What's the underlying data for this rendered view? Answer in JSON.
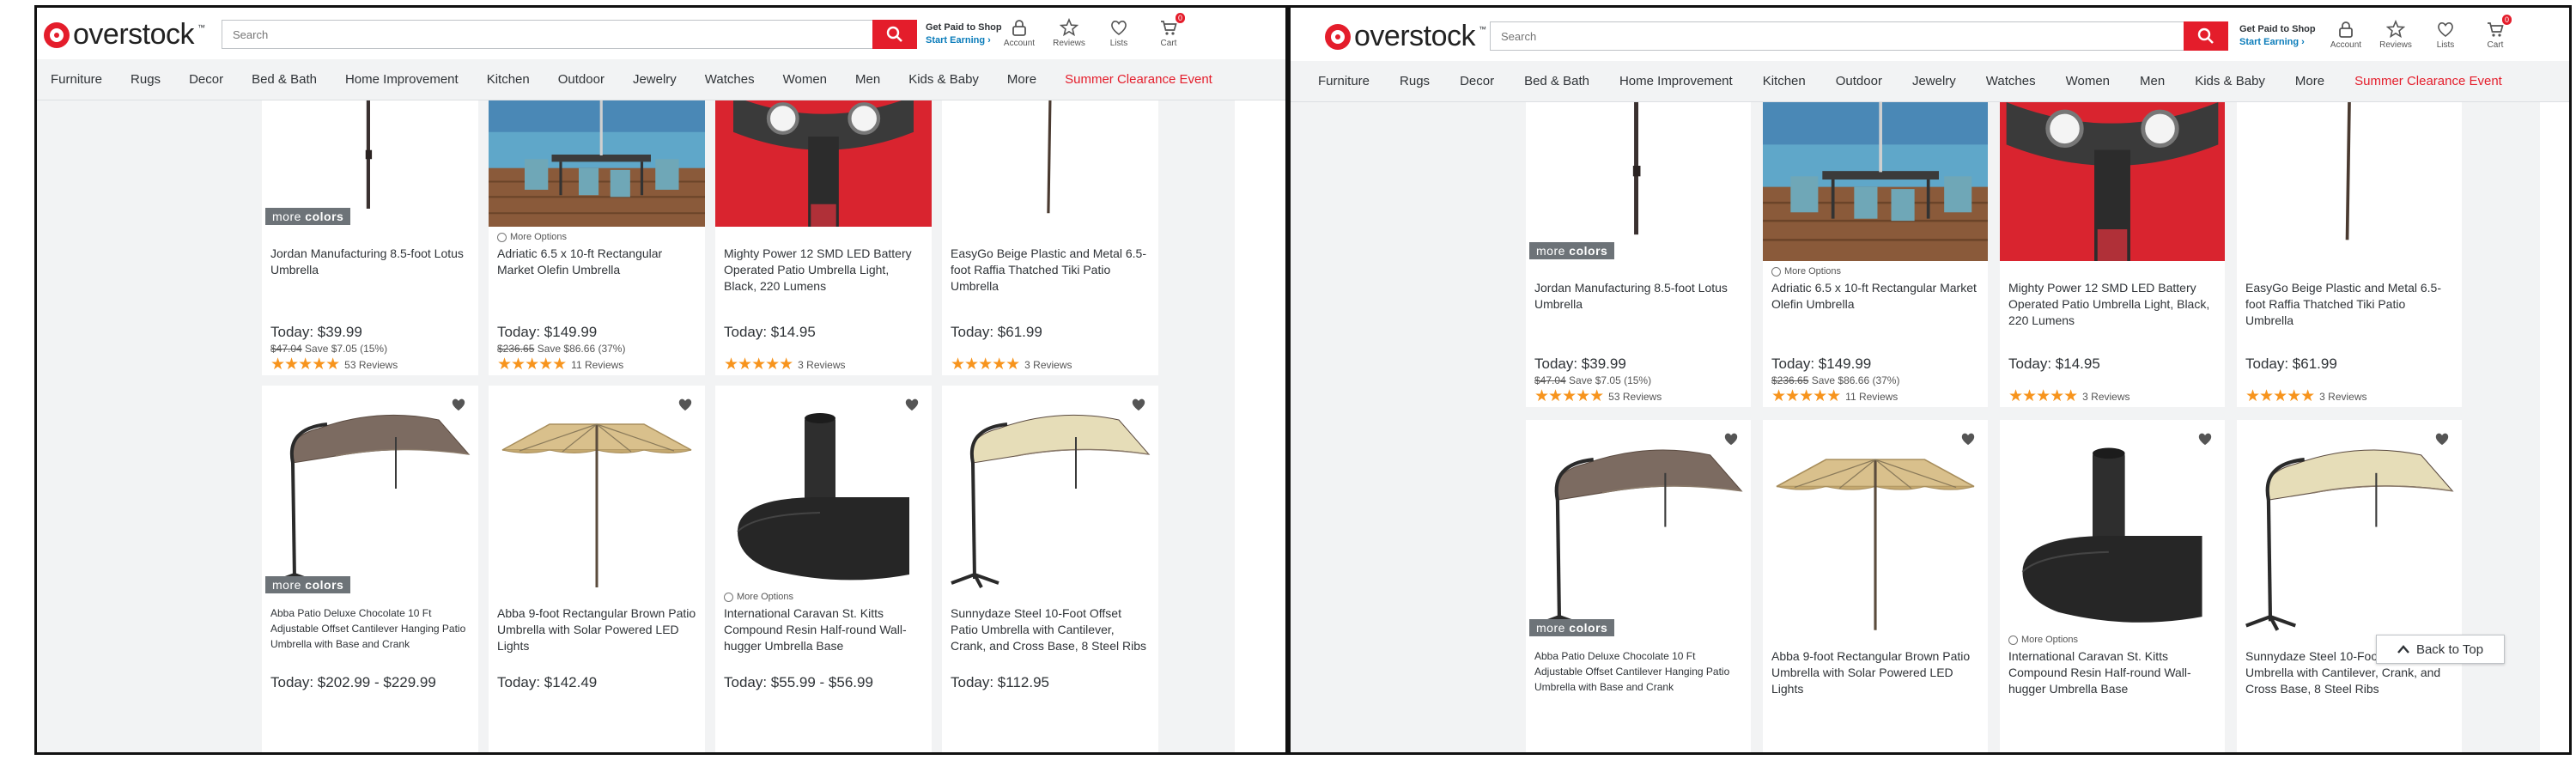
{
  "header": {
    "logo_text": "overstock",
    "search_placeholder": "Search",
    "earn_line1": "Get Paid to Shop",
    "earn_line2": "Start Earning ›",
    "account": "Account",
    "reviews": "Reviews",
    "lists": "Lists",
    "cart": "Cart",
    "cart_count": "0"
  },
  "nav": [
    "Furniture",
    "Rugs",
    "Decor",
    "Bed & Bath",
    "Home Improvement",
    "Kitchen",
    "Outdoor",
    "Jewelry",
    "Watches",
    "Women",
    "Men",
    "Kids & Baby",
    "More"
  ],
  "nav_sale": "Summer Clearance Event",
  "more_colors_label": "more colors",
  "more_options_label": "More Options",
  "back_to_top": "Back to Top",
  "products_row1": [
    {
      "title": "Jordan Manufacturing 8.5-foot Lotus Umbrella",
      "price": "Today: $39.99",
      "was": "$47.04",
      "save": "Save $7.05 (15%)",
      "stars": "★★★★★",
      "reviews": "53 Reviews",
      "more_colors": true,
      "more_options": false
    },
    {
      "title": "Adriatic 6.5 x 10-ft Rectangular Market Olefin Umbrella",
      "price": "Today: $149.99",
      "was": "$236.65",
      "save": "Save $86.66 (37%)",
      "stars": "★★★★★",
      "reviews": "11 Reviews",
      "more_colors": false,
      "more_options": true
    },
    {
      "title": "Mighty Power 12 SMD LED Battery Operated Patio Umbrella Light, Black, 220 Lumens",
      "price": "Today: $14.95",
      "was": "",
      "save": "",
      "stars": "★★★★★",
      "reviews": "3 Reviews",
      "more_colors": false,
      "more_options": false
    },
    {
      "title": "EasyGo Beige Plastic and Metal 6.5-foot Raffia Thatched Tiki Patio Umbrella",
      "price": "Today: $61.99",
      "was": "",
      "save": "",
      "stars": "★★★★★",
      "reviews": "3 Reviews",
      "more_colors": false,
      "more_options": false
    }
  ],
  "products_row2": [
    {
      "title": "Abba Patio Deluxe Chocolate 10 Ft Adjustable Offset Cantilever Hanging Patio Umbrella with Base and Crank",
      "price": "Today: $202.99 - $229.99",
      "more_colors": true,
      "more_options": false
    },
    {
      "title": "Abba 9-foot Rectangular Brown Patio Umbrella with Solar Powered LED Lights",
      "price": "Today: $142.49",
      "more_colors": false,
      "more_options": false
    },
    {
      "title": "International Caravan St. Kitts Compound Resin Half-round Wall-hugger Umbrella Base",
      "price": "Today: $55.99 - $56.99",
      "more_colors": false,
      "more_options": true
    },
    {
      "title": "Sunnydaze Steel 10-Foot Offset Patio Umbrella with Cantilever, Crank, and Cross Base, 8 Steel Ribs",
      "price": "Today: $112.95",
      "more_colors": false,
      "more_options": false
    }
  ],
  "colors": {
    "brand_red": "#e41d2b",
    "link_blue": "#0a7cba",
    "star_orange": "#f7941d",
    "nav_bg": "#f2f3f4"
  }
}
